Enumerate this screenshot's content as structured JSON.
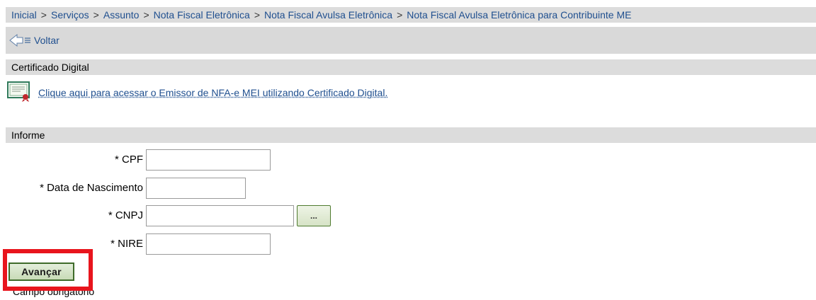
{
  "breadcrumb": {
    "items": [
      "Inicial",
      "Serviços",
      "Assunto",
      "Nota Fiscal Eletrônica",
      "Nota Fiscal Avulsa Eletrônica",
      "Nota Fiscal Avulsa Eletrônica para Contribuinte ME"
    ],
    "separator": ">"
  },
  "nav": {
    "back_label": "Voltar",
    "back_icon": "back-arrow-icon"
  },
  "cert": {
    "section_title": "Certificado Digital",
    "icon": "certificate-icon",
    "link_label": "Clique aqui para acessar o Emissor de NFA-e MEI utilizando Certificado Digital."
  },
  "form": {
    "section_title": "Informe",
    "cpf_label": "* CPF",
    "cpf_value": "",
    "nascimento_label": "* Data de Nascimento",
    "nascimento_value": "",
    "cnpj_label": "* CNPJ",
    "cnpj_value": "",
    "cnpj_lookup_label": "...",
    "nire_label": "* NIRE",
    "nire_value": "",
    "submit_label": "Avançar",
    "required_note": "Campo obrigatório"
  },
  "colors": {
    "accent": "#1f4f8f",
    "highlight": "#e8151d",
    "bar": "#dcdcdc"
  }
}
